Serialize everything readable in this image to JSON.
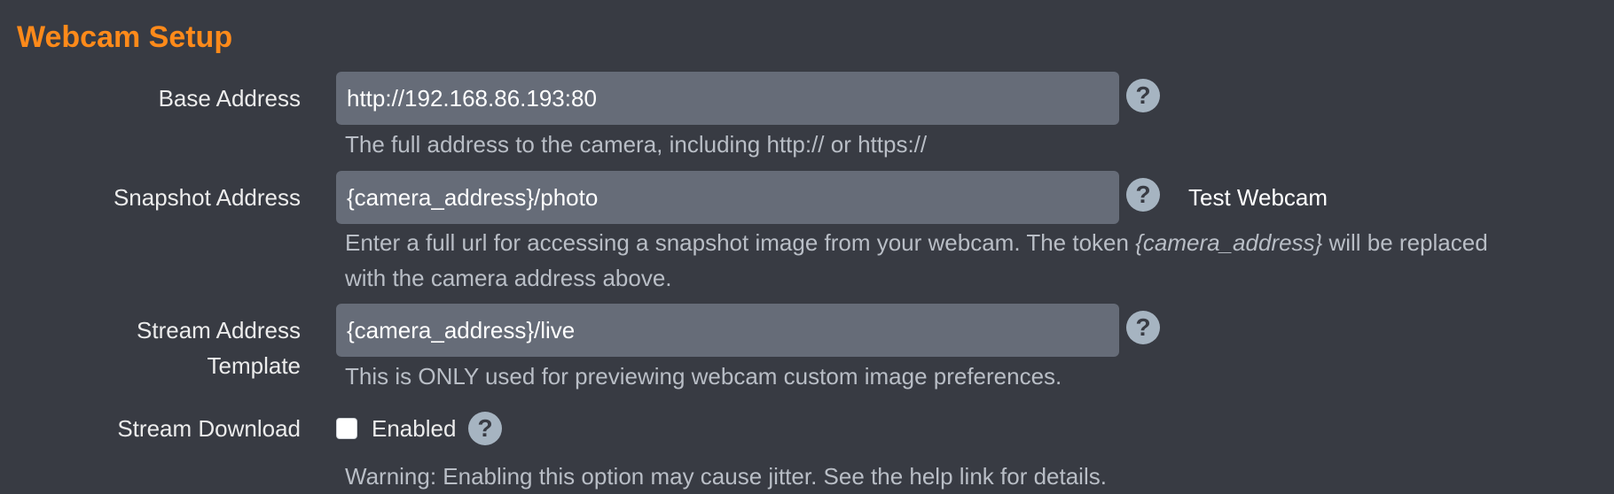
{
  "section": {
    "title": "Webcam Setup"
  },
  "fields": {
    "base_address": {
      "label": "Base Address",
      "value": "http://192.168.86.193:80",
      "hint": "The full address to the camera, including http:// or https://"
    },
    "snapshot_address": {
      "label": "Snapshot Address",
      "value": "{camera_address}/photo",
      "hint_before": "Enter a full url for accessing a snapshot image from your webcam. The token ",
      "hint_token": "{camera_address}",
      "hint_after": " will be replaced",
      "hint_line2": "with the camera address above.",
      "test_link": "Test Webcam"
    },
    "stream_address_template": {
      "label_line1": "Stream Address",
      "label_line2": "Template",
      "value": "{camera_address}/live",
      "hint": "This is ONLY used for previewing webcam custom image preferences."
    },
    "stream_download": {
      "label": "Stream Download",
      "checkbox_label": "Enabled",
      "checked": false,
      "hint": "Warning: Enabling this option may cause jitter. See the help link for details."
    }
  },
  "icons": {
    "help": "question-mark-circle-icon",
    "help_glyph": "?"
  },
  "colors": {
    "accent": "#ff8a1a",
    "background": "#383b43",
    "input_bg": "#666c78",
    "help_icon": "#a6b4c1"
  }
}
